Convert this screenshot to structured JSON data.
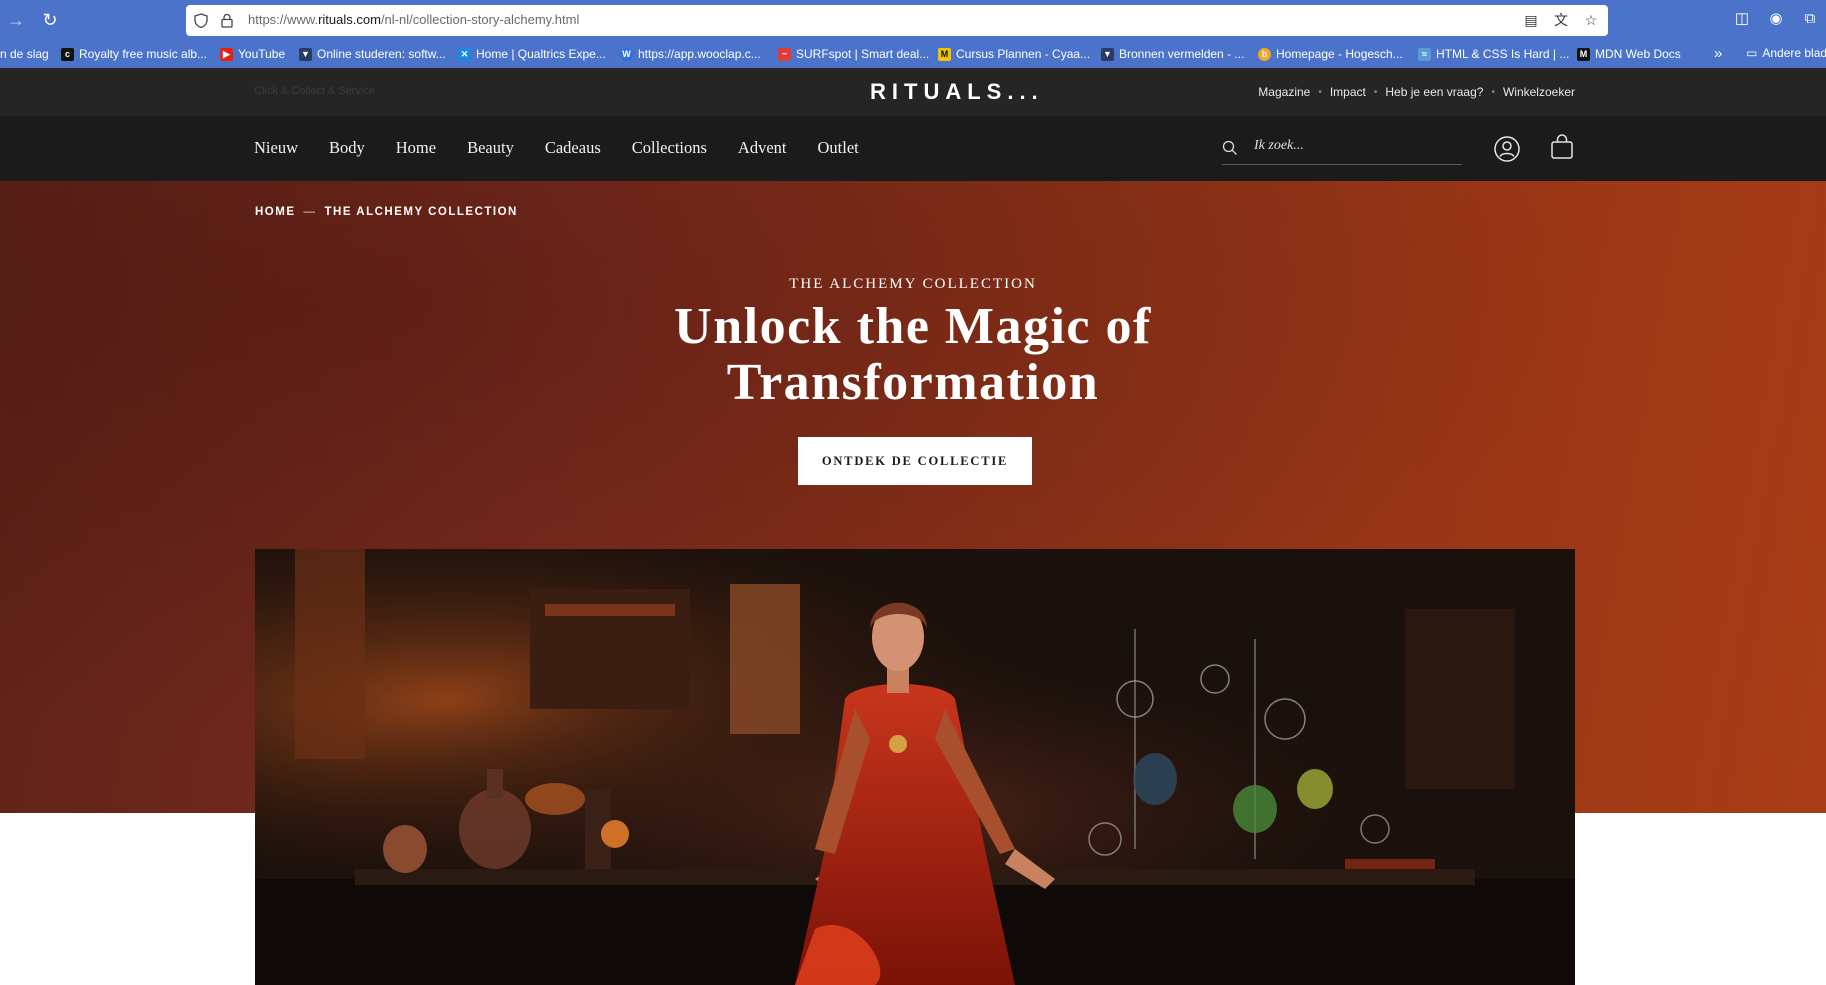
{
  "browser": {
    "url_prefix": "https://www.",
    "url_domain": "rituals.com",
    "url_path": "/nl-nl/collection-story-alchemy.html",
    "bookmarks": [
      {
        "label": "n de slag",
        "icon": "",
        "color": ""
      },
      {
        "label": "Royalty free music alb...",
        "icon": "c-icon",
        "color": "#111111"
      },
      {
        "label": "YouTube",
        "icon": "youtube-icon",
        "color": "#e62117"
      },
      {
        "label": "Online studeren: softw...",
        "icon": "shield-icon",
        "color": "#2a3b66"
      },
      {
        "label": "Home | Qualtrics Expe...",
        "icon": "qualtrics-icon",
        "color": "#1e88e5"
      },
      {
        "label": "https://app.wooclap.c...",
        "icon": "wooclap-icon",
        "color": "#2f6fe0"
      },
      {
        "label": "SURFspot | Smart deal...",
        "icon": "surf-icon",
        "color": "#e53935"
      },
      {
        "label": "Cursus Plannen - Cyaa...",
        "icon": "m-icon",
        "color": "#f2c500"
      },
      {
        "label": "Bronnen vermelden - ...",
        "icon": "shield-icon",
        "color": "#2a3b66"
      },
      {
        "label": "Homepage - Hogesch...",
        "icon": "h-icon",
        "color": "#f5a623"
      },
      {
        "label": "HTML & CSS Is Hard | ...",
        "icon": "wifi-icon",
        "color": "#5b9bd5"
      },
      {
        "label": "MDN Web Docs",
        "icon": "mdn-icon",
        "color": "#111111"
      }
    ],
    "bookmark_folder": "Andere blad"
  },
  "header": {
    "topbar_left": "Click & Collect & Service",
    "logo": "RITUALS...",
    "top_links": [
      "Magazine",
      "Impact",
      "Heb je een vraag?",
      "Winkelzoeker"
    ],
    "menu": [
      "Nieuw",
      "Body",
      "Home",
      "Beauty",
      "Cadeaus",
      "Collections",
      "Advent",
      "Outlet"
    ],
    "search_placeholder": "Ik zoek..."
  },
  "hero": {
    "breadcrumb_home": "HOME",
    "breadcrumb_sep": "—",
    "breadcrumb_current": "THE ALCHEMY COLLECTION",
    "kicker": "THE ALCHEMY COLLECTION",
    "title": "Unlock the Magic of Transformation",
    "cta": "ONTDEK DE COLLECTIE"
  },
  "colors": {
    "browser_chrome": "#4a73c9",
    "topbar": "#252525",
    "nav": "#1b1b1b",
    "hero_start": "#5c2218",
    "hero_end": "#a83c15"
  }
}
